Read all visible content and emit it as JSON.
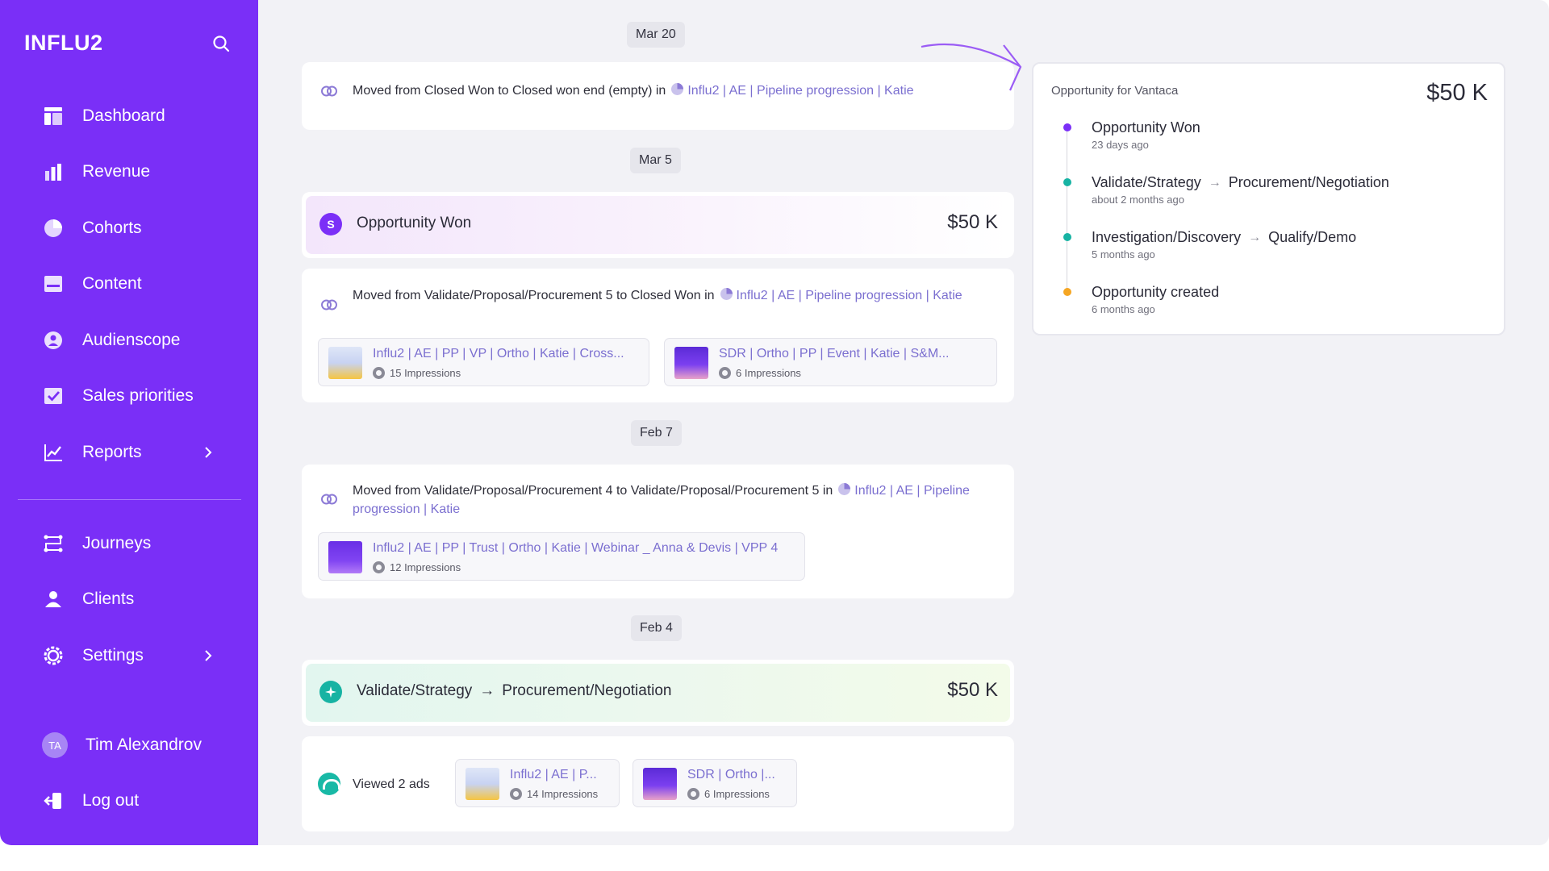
{
  "app": {
    "logo": "INFLU2"
  },
  "sidebar": {
    "items": [
      {
        "label": "Dashboard",
        "icon": "dashboard-icon"
      },
      {
        "label": "Revenue",
        "icon": "bar-chart-icon"
      },
      {
        "label": "Cohorts",
        "icon": "pie-chart-icon"
      },
      {
        "label": "Content",
        "icon": "content-icon"
      },
      {
        "label": "Audienscope",
        "icon": "audience-icon"
      },
      {
        "label": "Sales priorities",
        "icon": "checkbox-icon"
      },
      {
        "label": "Reports",
        "icon": "line-chart-icon"
      },
      {
        "label": "Journeys",
        "icon": "journeys-icon"
      },
      {
        "label": "Clients",
        "icon": "user-icon"
      },
      {
        "label": "Settings",
        "icon": "gear-icon"
      }
    ],
    "user": {
      "initials": "TA",
      "name": "Tim Alexandrov"
    },
    "logout": "Log out"
  },
  "feed": {
    "groups": [
      {
        "date": "Mar 20",
        "move_text": "Moved from Closed Won to Closed won end (empty) in",
        "pipeline": "Influ2 | AE | Pipeline progression | Katie"
      },
      {
        "date": "Mar 5",
        "stage": {
          "title": "Opportunity Won",
          "amount": "$50 K",
          "badge": "S"
        },
        "move_text": "Moved from Validate/Proposal/Procurement 5 to Closed Won in",
        "pipeline": "Influ2 | AE | Pipeline progression | Katie",
        "ads": [
          {
            "title": "Influ2 | AE | PP | VP | Ortho | Katie | Cross...",
            "impressions": "15 Impressions"
          },
          {
            "title": "SDR | Ortho | PP | Event | Katie | S&M...",
            "impressions": "6 Impressions"
          }
        ]
      },
      {
        "date": "Feb 7",
        "move_text": "Moved from Validate/Proposal/Procurement 4 to Validate/Proposal/Procurement 5 in",
        "pipeline": "Influ2 | AE | Pipeline progression | Katie",
        "ads": [
          {
            "title": "Influ2 | AE | PP | Trust | Ortho | Katie | Webinar _ Anna & Devis | VPP 4",
            "impressions": "12 Impressions"
          }
        ]
      },
      {
        "date": "Feb 4",
        "stage": {
          "from": "Validate/Strategy",
          "arrow": "→",
          "to": "Procurement/Negotiation",
          "amount": "$50 K"
        },
        "viewed": {
          "label": "Viewed 2 ads",
          "ads": [
            {
              "title": "Influ2 | AE | P...",
              "impressions": "14 Impressions"
            },
            {
              "title": "SDR | Ortho |...",
              "impressions": "6 Impressions"
            }
          ]
        }
      }
    ]
  },
  "opportunity": {
    "title": "Opportunity for Vantaca",
    "amount": "$50 K",
    "timeline": [
      {
        "name": "Opportunity Won",
        "time": "23 days ago",
        "color": "#7b2ff7"
      },
      {
        "from": "Validate/Strategy",
        "to": "Procurement/Negotiation",
        "arrow": "→",
        "time": "about 2 months ago",
        "color": "#17b3a3"
      },
      {
        "from": "Investigation/Discovery",
        "to": "Qualify/Demo",
        "arrow": "→",
        "time": "5 months ago",
        "color": "#17b3a3"
      },
      {
        "name": "Opportunity created",
        "time": "6 months ago",
        "color": "#f5a623"
      }
    ]
  },
  "colors": {
    "sidebar": "#7a2ff7",
    "link": "#7b6fd0",
    "teal": "#17b3a3",
    "won": "#7b2ff7"
  }
}
